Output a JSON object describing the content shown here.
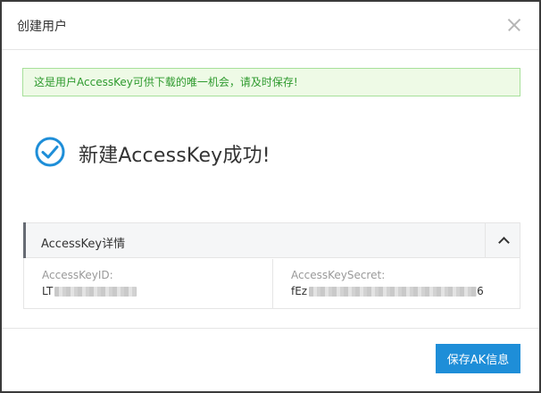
{
  "dialog": {
    "title": "创建用户",
    "close_icon": "close-icon"
  },
  "alert": {
    "text": "这是用户AccessKey可供下载的唯一机会，请及时保存!",
    "color": "#2e9a2e"
  },
  "success": {
    "icon": "check-circle-icon",
    "text": "新建AccessKey成功!",
    "icon_color": "#1e8ed8"
  },
  "panel": {
    "title": "AccessKey详情",
    "toggle_icon": "chevron-up-icon",
    "fields": [
      {
        "label": "AccessKeyID:",
        "value_prefix": "LT"
      },
      {
        "label": "AccessKeySecret:",
        "value_prefix": "fEz",
        "value_suffix": "6"
      }
    ]
  },
  "footer": {
    "save_label": "保存AK信息",
    "accent": "#1e8ed8"
  }
}
